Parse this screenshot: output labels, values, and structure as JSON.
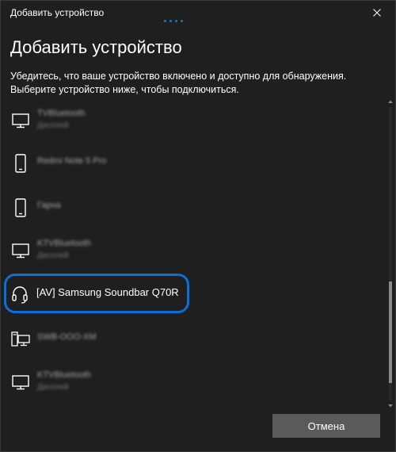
{
  "window": {
    "title": "Добавить устройство"
  },
  "heading": "Добавить устройство",
  "instructions": {
    "line1": "Убедитесь, что ваше устройство включено и доступно для обнаружения.",
    "line2": "Выберите устройство ниже, чтобы подключиться."
  },
  "devices": [
    {
      "icon": "monitor-icon",
      "name": "TVBluetooth",
      "type": "Дисплей"
    },
    {
      "icon": "phone-icon",
      "name": "Redmi Note 5 Pro",
      "type": ""
    },
    {
      "icon": "phone-icon",
      "name": "Гарна",
      "type": ""
    },
    {
      "icon": "monitor-icon",
      "name": "KTVBluetooth",
      "type": "Дисплей"
    },
    {
      "icon": "headset-icon",
      "name": "[AV] Samsung Soundbar Q70R",
      "type": ""
    },
    {
      "icon": "computer-icon",
      "name": "SWB-OOO-XM",
      "type": ""
    },
    {
      "icon": "monitor-icon",
      "name": "KTVBluetooth",
      "type": "Дисплей"
    }
  ],
  "buttons": {
    "cancel": "Отмена"
  },
  "colors": {
    "background": "#1f1f1f",
    "highlight": "#0a6fd8",
    "button": "#5a5a5a"
  }
}
